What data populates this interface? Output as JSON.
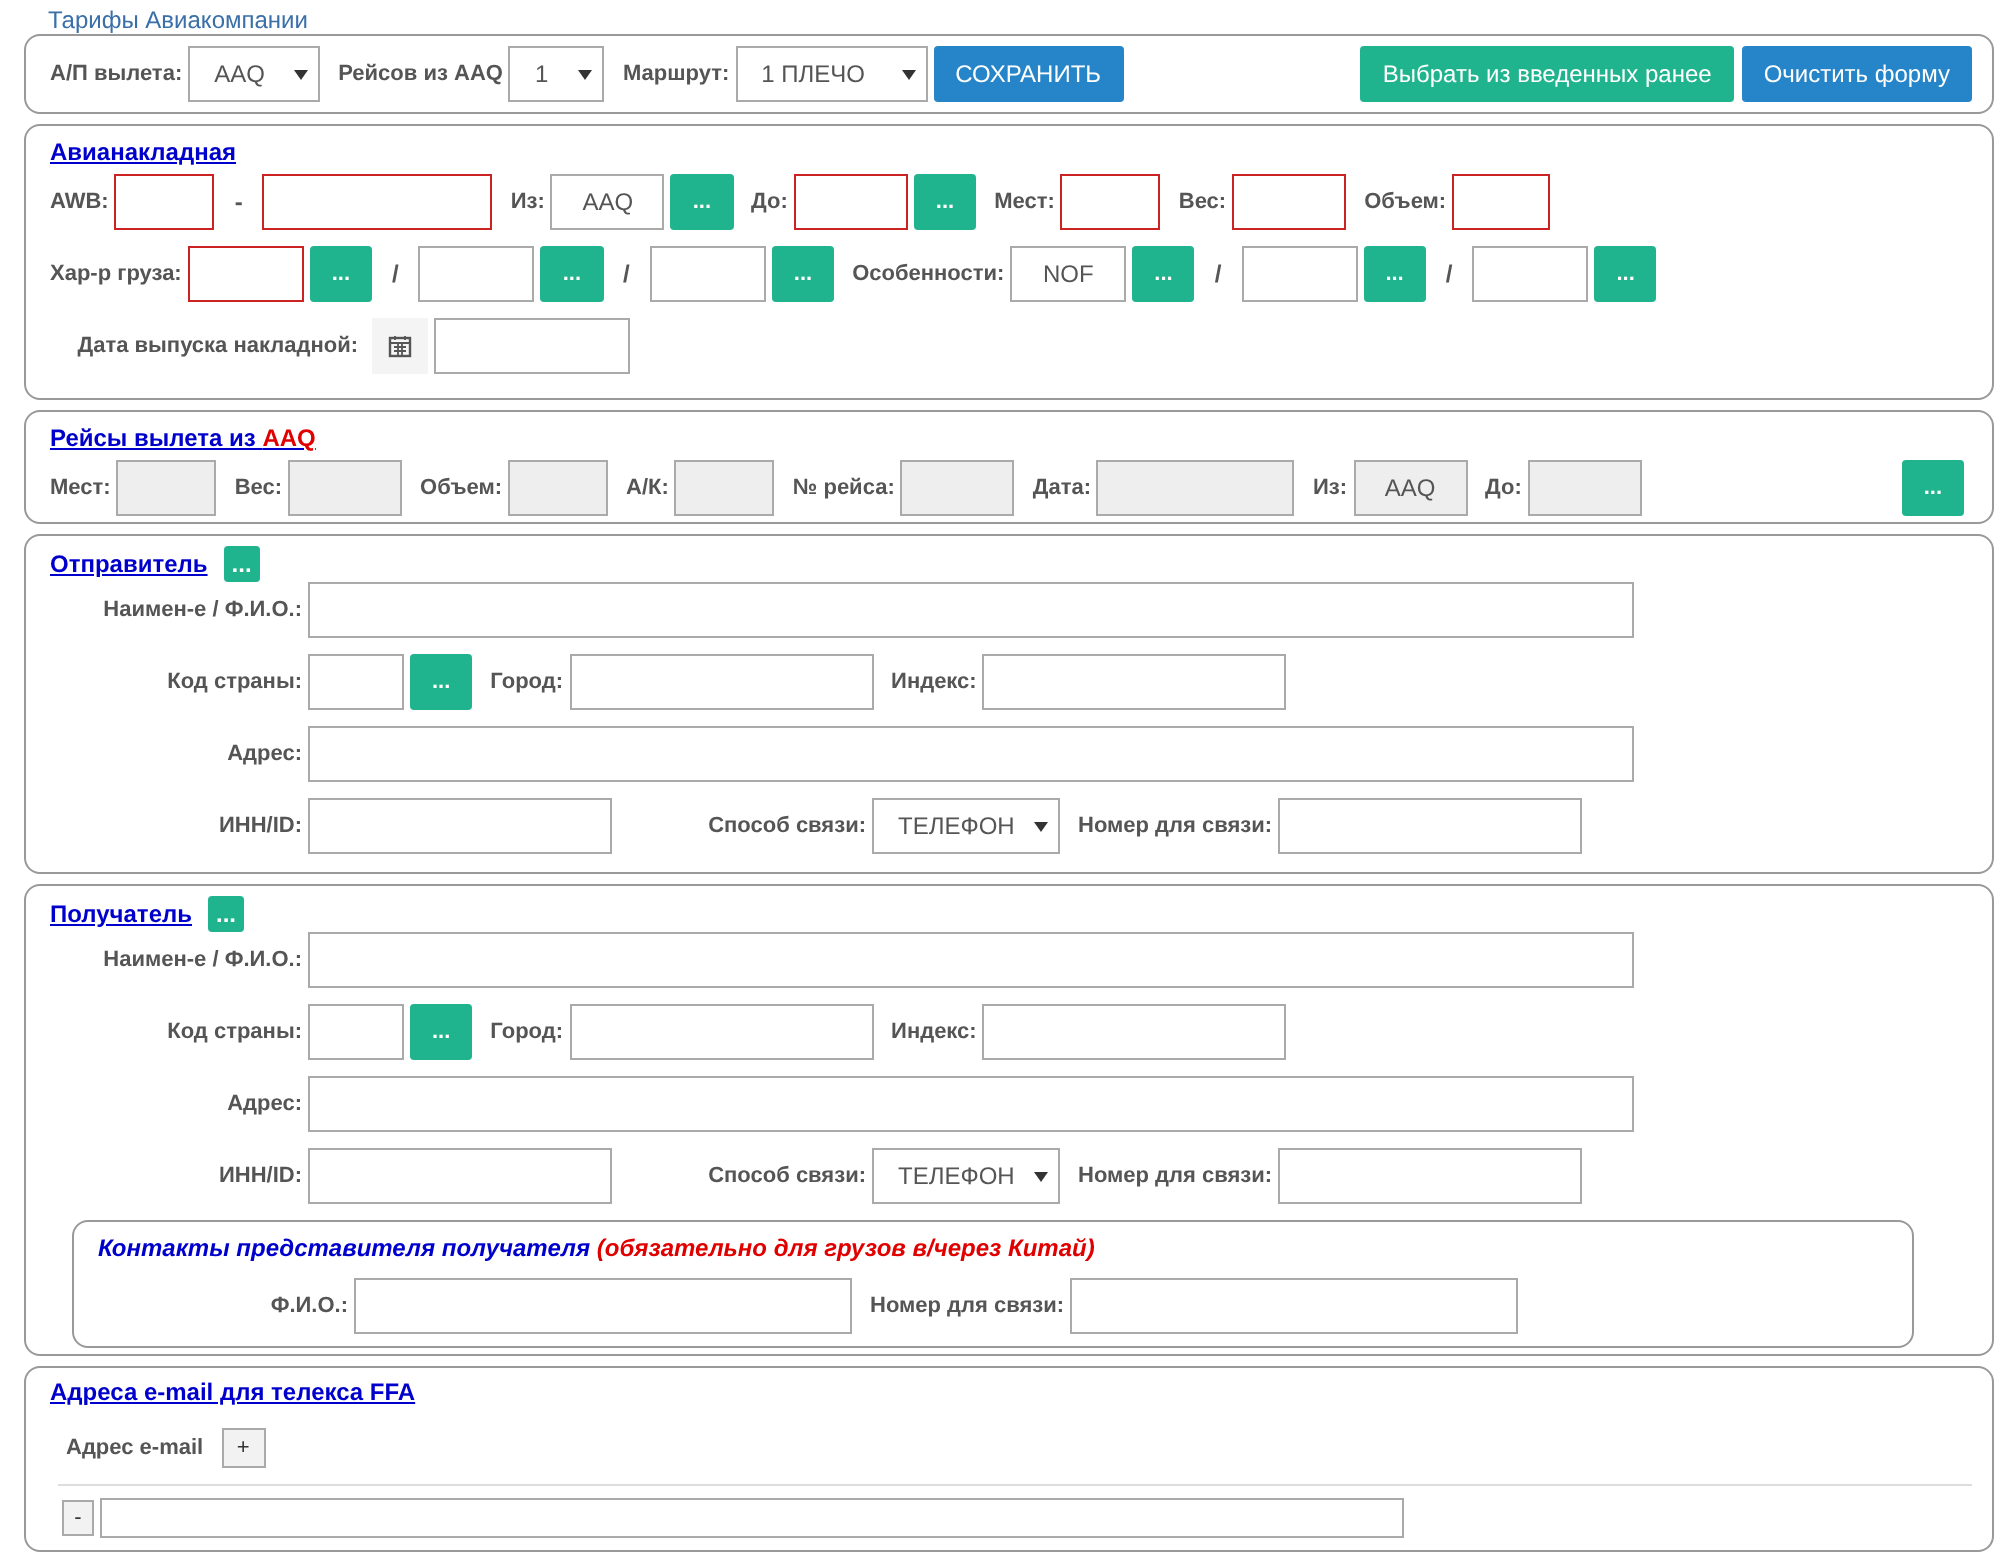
{
  "page_title": "Тарифы Авиакомпании",
  "toolbar": {
    "items": [
      {
        "kind": "label",
        "text": "А/П вылета:"
      },
      {
        "kind": "select",
        "value": "AAQ"
      },
      {
        "kind": "label",
        "text": "Рейсов из AAQ"
      },
      {
        "kind": "select",
        "value": "1"
      },
      {
        "kind": "label",
        "text": "Маршрут:"
      },
      {
        "kind": "select",
        "value": "1 ПЛЕЧО"
      },
      {
        "kind": "button",
        "text": "СОХРАНИТЬ"
      }
    ],
    "right_buttons": [
      {
        "text": "Выбрать из введенных ранее"
      },
      {
        "text": "Очистить форму"
      }
    ]
  },
  "waybill": {
    "title": "Авианакладная",
    "rows": [
      {
        "items": [
          {
            "kind": "label",
            "text": "AWB:"
          },
          {
            "kind": "input",
            "required": true
          },
          {
            "kind": "sep",
            "text": "-"
          },
          {
            "kind": "input",
            "required": true
          },
          {
            "kind": "label",
            "text": "Из:"
          },
          {
            "kind": "input",
            "value": "AAQ",
            "required": false
          },
          {
            "kind": "lookup",
            "text": "..."
          },
          {
            "kind": "label",
            "text": "До:"
          },
          {
            "kind": "input",
            "required": true
          },
          {
            "kind": "lookup",
            "text": "..."
          },
          {
            "kind": "label",
            "text": "Мест:"
          },
          {
            "kind": "input",
            "required": true
          },
          {
            "kind": "label",
            "text": "Вес:"
          },
          {
            "kind": "input",
            "required": true
          },
          {
            "kind": "label",
            "text": "Объем:"
          },
          {
            "kind": "input",
            "required": true
          }
        ]
      },
      {
        "items": [
          {
            "kind": "label",
            "text": "Хар-р груза:"
          },
          {
            "kind": "input",
            "required": true
          },
          {
            "kind": "lookup",
            "text": "..."
          },
          {
            "kind": "sep",
            "text": "/"
          },
          {
            "kind": "input",
            "required": false
          },
          {
            "kind": "lookup",
            "text": "..."
          },
          {
            "kind": "sep",
            "text": "/"
          },
          {
            "kind": "input",
            "required": false
          },
          {
            "kind": "lookup",
            "text": "..."
          },
          {
            "kind": "label",
            "text": "Особенности:"
          },
          {
            "kind": "input",
            "value": "NOF",
            "required": false
          },
          {
            "kind": "lookup",
            "text": "..."
          },
          {
            "kind": "sep",
            "text": "/"
          },
          {
            "kind": "input",
            "required": false
          },
          {
            "kind": "lookup",
            "text": "..."
          },
          {
            "kind": "sep",
            "text": "/"
          },
          {
            "kind": "input",
            "required": false
          },
          {
            "kind": "lookup",
            "text": "..."
          }
        ]
      },
      {
        "items": [
          {
            "kind": "label",
            "text": "Дата выпуска накладной:"
          },
          {
            "kind": "calendar"
          },
          {
            "kind": "input",
            "required": false
          }
        ]
      }
    ]
  },
  "flights": {
    "title": "Рейсы вылета из ",
    "title_code": "AAQ",
    "fields": [
      {
        "label": "Мест:",
        "readonly": true
      },
      {
        "label": "Вес:",
        "readonly": true
      },
      {
        "label": "Объем:",
        "readonly": true
      },
      {
        "label": "А/К:",
        "readonly": true
      },
      {
        "label": "№ рейса:",
        "readonly": true
      },
      {
        "label": "Дата:",
        "readonly": true
      },
      {
        "label": "Из:",
        "value": "AAQ",
        "readonly": true
      },
      {
        "label": "До:",
        "readonly": true
      }
    ],
    "button": "..."
  },
  "parties": [
    {
      "title": "Отправитель",
      "button": "...",
      "rows": [
        {
          "items": [
            {
              "kind": "label",
              "text": "Наимен-е / Ф.И.О.:"
            },
            {
              "kind": "input"
            }
          ]
        },
        {
          "items": [
            {
              "kind": "label",
              "text": "Код страны:"
            },
            {
              "kind": "input"
            },
            {
              "kind": "lookup",
              "text": "..."
            },
            {
              "kind": "label",
              "text": "Город:"
            },
            {
              "kind": "input"
            },
            {
              "kind": "label",
              "text": "Индекс:"
            },
            {
              "kind": "input"
            }
          ]
        },
        {
          "items": [
            {
              "kind": "label",
              "text": "Адрес:"
            },
            {
              "kind": "input"
            }
          ]
        },
        {
          "items": [
            {
              "kind": "label",
              "text": "ИНН/ID:"
            },
            {
              "kind": "input"
            },
            {
              "kind": "label",
              "text": "Способ связи:"
            },
            {
              "kind": "select",
              "value": "ТЕЛЕФОН"
            },
            {
              "kind": "label",
              "text": "Номер для связи:"
            },
            {
              "kind": "input"
            }
          ]
        }
      ]
    },
    {
      "title": "Получатель",
      "button": "...",
      "rows": [
        {
          "items": [
            {
              "kind": "label",
              "text": "Наимен-е / Ф.И.О.:"
            },
            {
              "kind": "input"
            }
          ]
        },
        {
          "items": [
            {
              "kind": "label",
              "text": "Код страны:"
            },
            {
              "kind": "input"
            },
            {
              "kind": "lookup",
              "text": "..."
            },
            {
              "kind": "label",
              "text": "Город:"
            },
            {
              "kind": "input"
            },
            {
              "kind": "label",
              "text": "Индекс:"
            },
            {
              "kind": "input"
            }
          ]
        },
        {
          "items": [
            {
              "kind": "label",
              "text": "Адрес:"
            },
            {
              "kind": "input"
            }
          ]
        },
        {
          "items": [
            {
              "kind": "label",
              "text": "ИНН/ID:"
            },
            {
              "kind": "input"
            },
            {
              "kind": "label",
              "text": "Способ связи:"
            },
            {
              "kind": "select",
              "value": "ТЕЛЕФОН"
            },
            {
              "kind": "label",
              "text": "Номер для связи:"
            },
            {
              "kind": "input"
            }
          ]
        }
      ],
      "contacts": {
        "title": "Контакты представителя получателя",
        "note": "(обязательно для грузов в/через Китай)",
        "items": [
          {
            "kind": "label",
            "text": "Ф.И.О.:"
          },
          {
            "kind": "input"
          },
          {
            "kind": "label",
            "text": "Номер для связи:"
          },
          {
            "kind": "input"
          }
        ]
      }
    }
  ],
  "emails": {
    "title": "Адреса e-mail для телекса FFA",
    "label": "Адрес e-mail",
    "add_button": "+",
    "entries": [
      {
        "remove_button": "-"
      }
    ]
  }
}
